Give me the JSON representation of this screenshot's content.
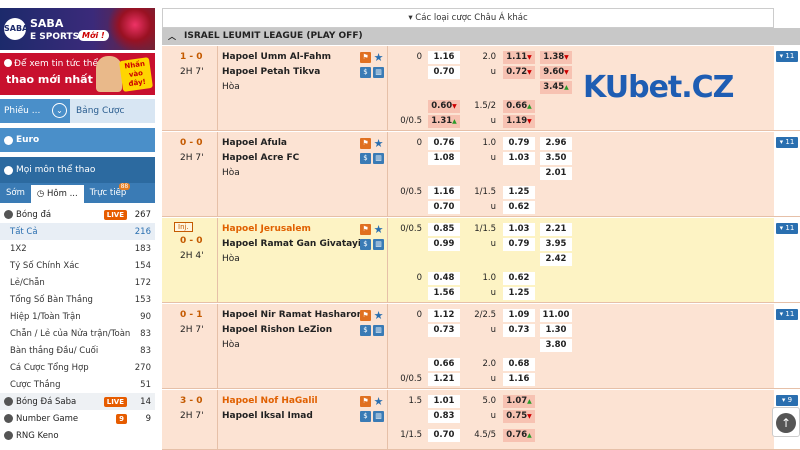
{
  "sidebar": {
    "banner_saba": {
      "logo": "SABA",
      "title": "SABA",
      "subtitle": "E SPORTS",
      "badge": "Mới !"
    },
    "banner_news": {
      "line1": "Để xem tin tức thể",
      "line2": "thao mới nhất",
      "badge": "Nhấn vào đây!"
    },
    "btn_phieu": "Phiếu ...",
    "btn_bang": "Bảng Cược",
    "euro": "Euro",
    "moi_mon": "Mọi môn thể thao",
    "tabs": [
      {
        "label": "Sớm"
      },
      {
        "label": "Hôm ..."
      },
      {
        "label": "Trực tiếp",
        "badge": "88"
      }
    ],
    "sports": [
      {
        "name": "Bóng đá",
        "count": "267",
        "live": "LIVE",
        "type": "sport"
      },
      {
        "name": "Tất Cả",
        "count": "216",
        "type": "sel"
      },
      {
        "name": "1X2",
        "count": "183",
        "type": "sub"
      },
      {
        "name": "Tỷ Số Chính Xác",
        "count": "154",
        "type": "sub"
      },
      {
        "name": "Lẻ/Chẵn",
        "count": "172",
        "type": "sub"
      },
      {
        "name": "Tổng Số Bàn Thắng",
        "count": "153",
        "type": "sub"
      },
      {
        "name": "Hiệp 1/Toàn Trận",
        "count": "90",
        "type": "sub"
      },
      {
        "name": "Chẵn / Lẻ của Nửa trận/Toàn",
        "count": "83",
        "type": "sub"
      },
      {
        "name": "Bàn thắng Đầu/ Cuối",
        "count": "83",
        "type": "sub"
      },
      {
        "name": "Cá Cược Tổng Hợp",
        "count": "270",
        "type": "sub"
      },
      {
        "name": "Cược Thắng",
        "count": "51",
        "type": "sub"
      },
      {
        "name": "Bóng Đá Saba",
        "count": "14",
        "live": "LIVE",
        "type": "sport grey"
      },
      {
        "name": "Number Game",
        "count": "9",
        "live": "9",
        "type": "sport"
      },
      {
        "name": "RNG Keno",
        "count": "",
        "type": "sport"
      }
    ]
  },
  "main": {
    "topbar": "▾ Các loại cược Châu Á khác",
    "league": "ISRAEL LEUMIT LEAGUE (PLAY OFF)",
    "more_label": "▾ 11",
    "more_label_last": "▾ 9",
    "draw_label": "Hòa",
    "matches": [
      {
        "score": "1 - 0",
        "time": "2H 7'",
        "home": "Hapoel Umm Al-Fahm",
        "away": "Hapoel Petah Tikva",
        "ft_hdp": "0",
        "ft_home": "1.16",
        "ft_away": "0.70",
        "ou_line": "2.0",
        "ou_over": "1.11",
        "ou_under": "0.72",
        "ou_u": "u",
        "x1": "1.38",
        "x2": "9.60",
        "xd": "3.45",
        "hdp2": "",
        "h2_home": "0.60",
        "h2_away": "1.31",
        "hdp2_side": "0/0.5",
        "ou2_line": "1.5/2",
        "ou2_over": "0.66",
        "ou2_under": "1.19"
      },
      {
        "score": "0 - 0",
        "time": "2H 7'",
        "home": "Hapoel Afula",
        "away": "Hapoel Acre FC",
        "ft_hdp": "0",
        "ft_home": "0.76",
        "ft_away": "1.08",
        "ou_line": "1.0",
        "ou_over": "0.79",
        "ou_under": "1.03",
        "ou_u": "u",
        "x1": "2.96",
        "x2": "3.50",
        "xd": "2.01",
        "hdp2": "0/0.5",
        "h2_home": "1.16",
        "h2_away": "0.70",
        "ou2_line": "1/1.5",
        "ou2_over": "1.25",
        "ou2_under": "0.62"
      },
      {
        "inj": "Inj.",
        "score": "0 - 0",
        "time": "2H 4'",
        "home": "Hapoel Jerusalem",
        "away": "Hapoel Ramat Gan Givatayim",
        "ft_hdp": "0/0.5",
        "ft_home": "0.85",
        "ft_away": "0.99",
        "ou_line": "1/1.5",
        "ou_over": "1.03",
        "ou_under": "0.79",
        "ou_u": "u",
        "x1": "2.21",
        "x2": "3.95",
        "xd": "2.42",
        "hdp2": "0",
        "h2_home": "0.48",
        "h2_away": "1.56",
        "ou2_line": "1.0",
        "ou2_over": "0.62",
        "ou2_under": "1.25"
      },
      {
        "score": "0 - 1",
        "time": "2H 7'",
        "home": "Hapoel Nir Ramat Hasharon",
        "away": "Hapoel Rishon LeZion",
        "ft_hdp": "0",
        "ft_home": "1.12",
        "ft_away": "0.73",
        "ou_line": "2/2.5",
        "ou_over": "1.09",
        "ou_under": "0.73",
        "ou_u": "u",
        "x1": "11.00",
        "x2": "1.30",
        "xd": "3.80",
        "hdp2": "",
        "h2_home": "0.66",
        "h2_away": "1.21",
        "hdp2_side": "0/0.5",
        "ou2_line": "2.0",
        "ou2_over": "0.68",
        "ou2_under": "1.16"
      },
      {
        "score": "3 - 0",
        "time": "2H 7'",
        "home": "Hapoel Nof HaGalil",
        "away": "Hapoel Iksal Imad",
        "ft_hdp": "1.5",
        "ft_home": "1.01",
        "ft_away": "0.83",
        "ou_line": "5.0",
        "ou_over": "1.07",
        "ou_under": "0.75",
        "ou_u": "u",
        "hdp2": "1/1.5",
        "h2_home": "0.70",
        "ou2_line": "4.5/5",
        "ou2_over": "0.76"
      }
    ]
  },
  "watermark": {
    "ku": "KU",
    "rest": "bet.CZ"
  }
}
